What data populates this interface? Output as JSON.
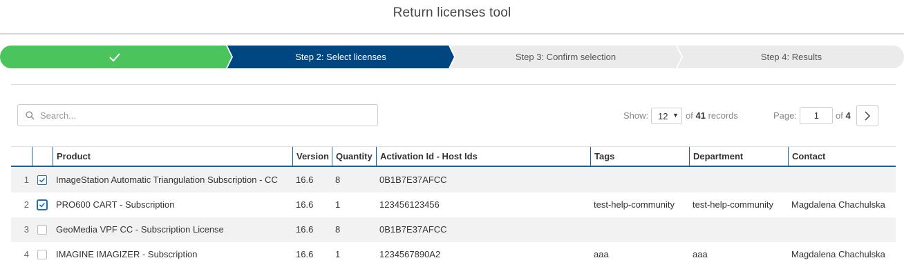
{
  "app": {
    "title": "Return licenses tool"
  },
  "stepper": {
    "steps": [
      {
        "label": "",
        "state": "done",
        "icon": "checkmark-icon"
      },
      {
        "label": "Step 2: Select licenses",
        "state": "active"
      },
      {
        "label": "Step 3: Confirm selection",
        "state": "pending"
      },
      {
        "label": "Step 4: Results",
        "state": "pending"
      }
    ],
    "colors": {
      "done": "#4cc45e",
      "active": "#004680",
      "pending": "#ebebeb"
    }
  },
  "search": {
    "placeholder": "Search...",
    "value": "",
    "icon": "search-icon"
  },
  "paging": {
    "show_label": "Show:",
    "page_size": "12",
    "records_prefix": "of",
    "records_total": "41",
    "records_suffix": "records",
    "page_label": "Page:",
    "page_value": "1",
    "of_label": "of",
    "total_pages": "4"
  },
  "table": {
    "columns": [
      "Product",
      "Version",
      "Quantity",
      "Activation Id - Host Ids",
      "Tags",
      "Department",
      "Contact"
    ],
    "rows": [
      {
        "num": "1",
        "checked": true,
        "product": "ImageStation Automatic Triangulation Subscription - CC",
        "version": "16.6",
        "quantity": "8",
        "activation": "0B1B7E37AFCC",
        "tags": "",
        "department": "",
        "contact": ""
      },
      {
        "num": "2",
        "checked": true,
        "product": "PRO600 CART - Subscription",
        "version": "16.6",
        "quantity": "1",
        "activation": "123456123456",
        "tags": "test-help-community",
        "department": "test-help-community",
        "contact": "Magdalena Chachulska"
      },
      {
        "num": "3",
        "checked": false,
        "product": "GeoMedia VPF CC - Subscription License",
        "version": "16.6",
        "quantity": "8",
        "activation": "0B1B7E37AFCC",
        "tags": "",
        "department": "",
        "contact": ""
      },
      {
        "num": "4",
        "checked": false,
        "product": "IMAGINE IMAGIZER - Subscription",
        "version": "16.6",
        "quantity": "1",
        "activation": "1234567890A2",
        "tags": "aaa",
        "department": "aaa",
        "contact": "Magdalena Chachulska"
      }
    ]
  }
}
